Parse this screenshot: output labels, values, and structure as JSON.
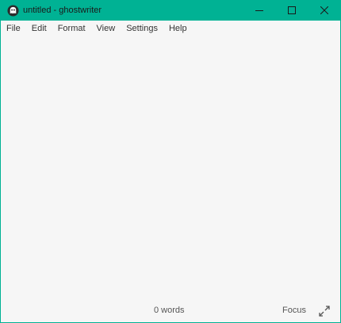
{
  "window": {
    "title": "untitled - ghostwriter",
    "accent_color": "#00b294",
    "icon": "ghostwriter-app-icon"
  },
  "controls": {
    "minimize_icon": "minimize-icon",
    "maximize_icon": "maximize-icon",
    "close_icon": "close-icon"
  },
  "menubar": {
    "items": [
      {
        "label": "File"
      },
      {
        "label": "Edit"
      },
      {
        "label": "Format"
      },
      {
        "label": "View"
      },
      {
        "label": "Settings"
      },
      {
        "label": "Help"
      }
    ]
  },
  "editor": {
    "content": ""
  },
  "statusbar": {
    "word_count": "0 words",
    "focus_label": "Focus",
    "fullscreen_icon": "fullscreen-icon"
  }
}
